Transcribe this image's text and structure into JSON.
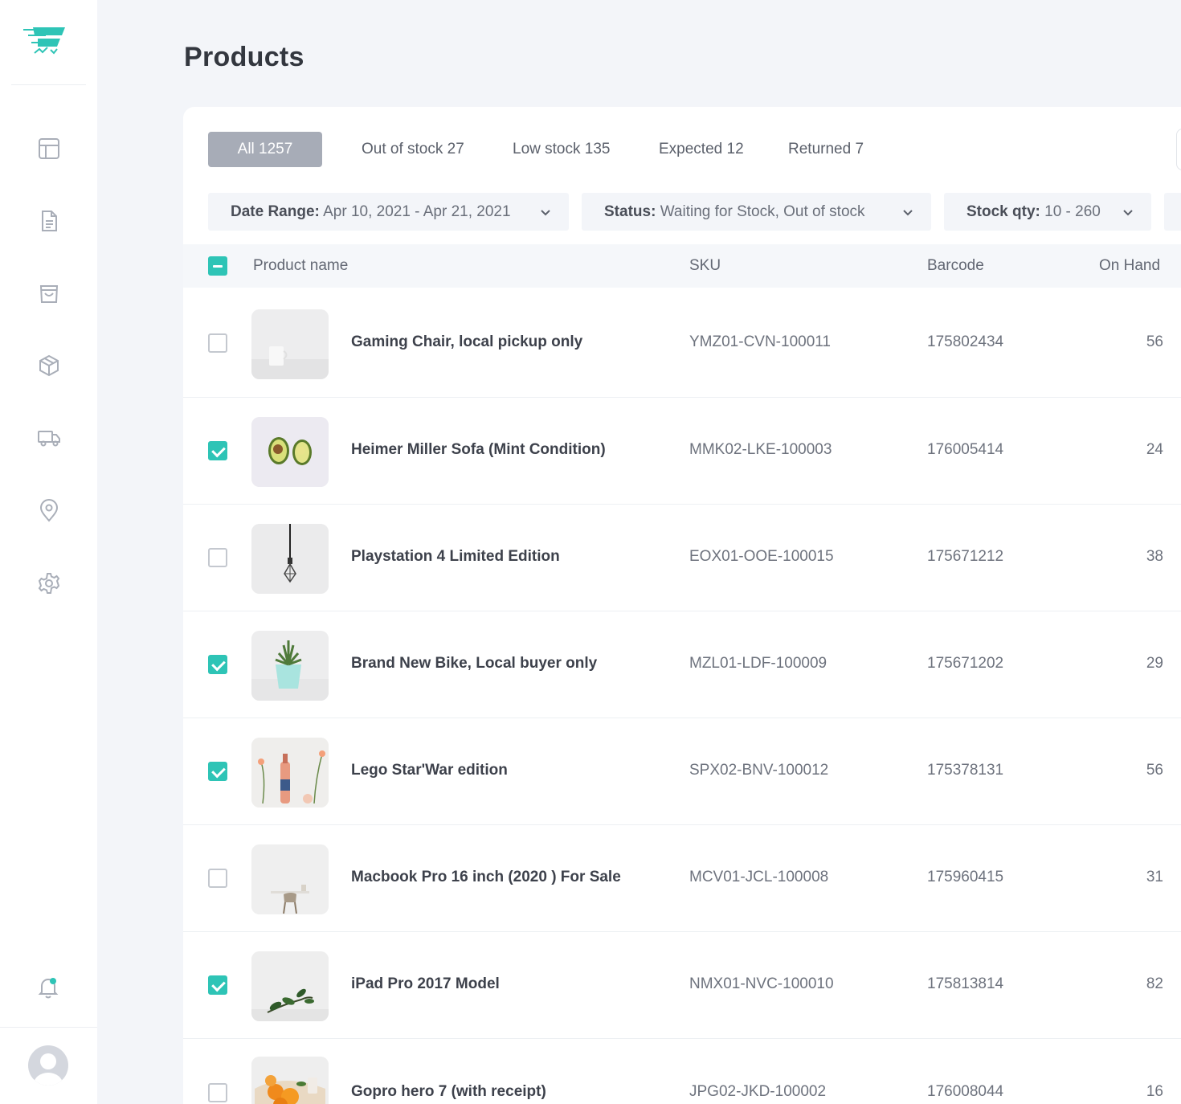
{
  "page": {
    "title": "Products"
  },
  "sidebar": {
    "nav": [
      "dashboard-icon",
      "document-icon",
      "shopping-bag-icon",
      "box-icon",
      "truck-icon",
      "location-pin-icon",
      "settings-gear-icon"
    ],
    "bottom": [
      "bell-icon",
      "avatar"
    ]
  },
  "tabs": [
    {
      "label": "All 1257",
      "active": true
    },
    {
      "label": "Out of stock 27",
      "active": false
    },
    {
      "label": "Low stock 135",
      "active": false
    },
    {
      "label": "Expected 12",
      "active": false
    },
    {
      "label": "Returned 7",
      "active": false
    }
  ],
  "filters": {
    "date_range": {
      "label": "Date Range:",
      "value": "Apr 10, 2021 -  Apr 21, 2021"
    },
    "status": {
      "label": "Status:",
      "value": "Waiting for Stock, Out of stock"
    },
    "stock_qty": {
      "label": "Stock qty:",
      "value": "10 - 260"
    }
  },
  "table": {
    "columns": [
      "Product name",
      "SKU",
      "Barcode",
      "On Hand"
    ],
    "rows": [
      {
        "checked": false,
        "name": "Gaming Chair, local pickup only",
        "sku": "YMZ01-CVN-100011",
        "barcode": "175802434",
        "on_hand": "56"
      },
      {
        "checked": true,
        "name": "Heimer Miller Sofa (Mint Condition)",
        "sku": "MMK02-LKE-100003",
        "barcode": "176005414",
        "on_hand": "24"
      },
      {
        "checked": false,
        "name": "Playstation 4 Limited Edition",
        "sku": "EOX01-OOE-100015",
        "barcode": "175671212",
        "on_hand": "38"
      },
      {
        "checked": true,
        "name": "Brand New Bike, Local buyer only",
        "sku": "MZL01-LDF-100009",
        "barcode": "175671202",
        "on_hand": "29"
      },
      {
        "checked": true,
        "name": "Lego Star'War edition",
        "sku": "SPX02-BNV-100012",
        "barcode": "175378131",
        "on_hand": "56"
      },
      {
        "checked": false,
        "name": "Macbook Pro 16 inch (2020 ) For Sale",
        "sku": "MCV01-JCL-100008",
        "barcode": "175960415",
        "on_hand": "31"
      },
      {
        "checked": true,
        "name": "iPad Pro 2017 Model",
        "sku": "NMX01-NVC-100010",
        "barcode": "175813814",
        "on_hand": "82"
      },
      {
        "checked": false,
        "name": "Gopro hero 7 (with receipt)",
        "sku": "JPG02-JKD-100002",
        "barcode": "176008044",
        "on_hand": "16"
      }
    ]
  },
  "colors": {
    "accent": "#2ec4b6",
    "active_tab": "#a7acb7",
    "background": "#f3f5f9"
  }
}
